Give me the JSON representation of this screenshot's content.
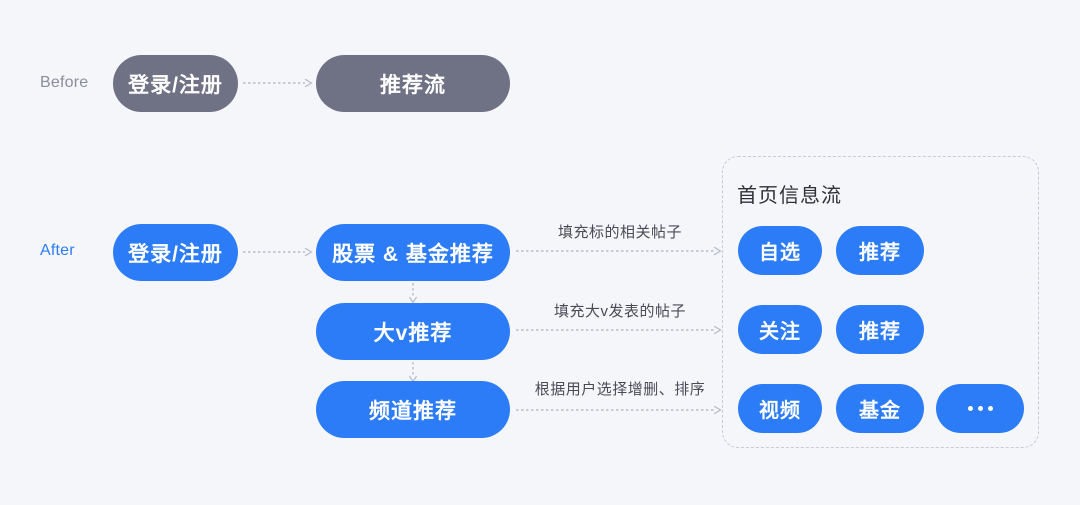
{
  "theme": {
    "background": "#f5f6fa",
    "accent_blue": "#2d7cf7",
    "gray_pill": "#6f7184",
    "panel_border": "#c7cad6",
    "caption_text": "#4a4b55",
    "before_label_color": "#8b8d9b"
  },
  "rows": {
    "before_label": "Before",
    "after_label": "After"
  },
  "before_flow": {
    "steps": [
      {
        "label": "登录/注册"
      },
      {
        "label": "推荐流"
      }
    ]
  },
  "after_flow": {
    "entry": {
      "label": "登录/注册"
    },
    "stages": [
      {
        "label": "股票 & 基金推荐",
        "caption": "填充标的相关帖子"
      },
      {
        "label": "大v推荐",
        "caption": "填充大v发表的帖子"
      },
      {
        "label": "频道推荐",
        "caption": "根据用户选择增删、排序"
      }
    ]
  },
  "feed_panel": {
    "title": "首页信息流",
    "rows": [
      {
        "tabs": [
          {
            "label": "自选"
          },
          {
            "label": "推荐"
          }
        ]
      },
      {
        "tabs": [
          {
            "label": "关注"
          },
          {
            "label": "推荐"
          }
        ]
      },
      {
        "tabs": [
          {
            "label": "视频"
          },
          {
            "label": "基金"
          },
          {
            "label": "..."
          }
        ]
      }
    ]
  }
}
